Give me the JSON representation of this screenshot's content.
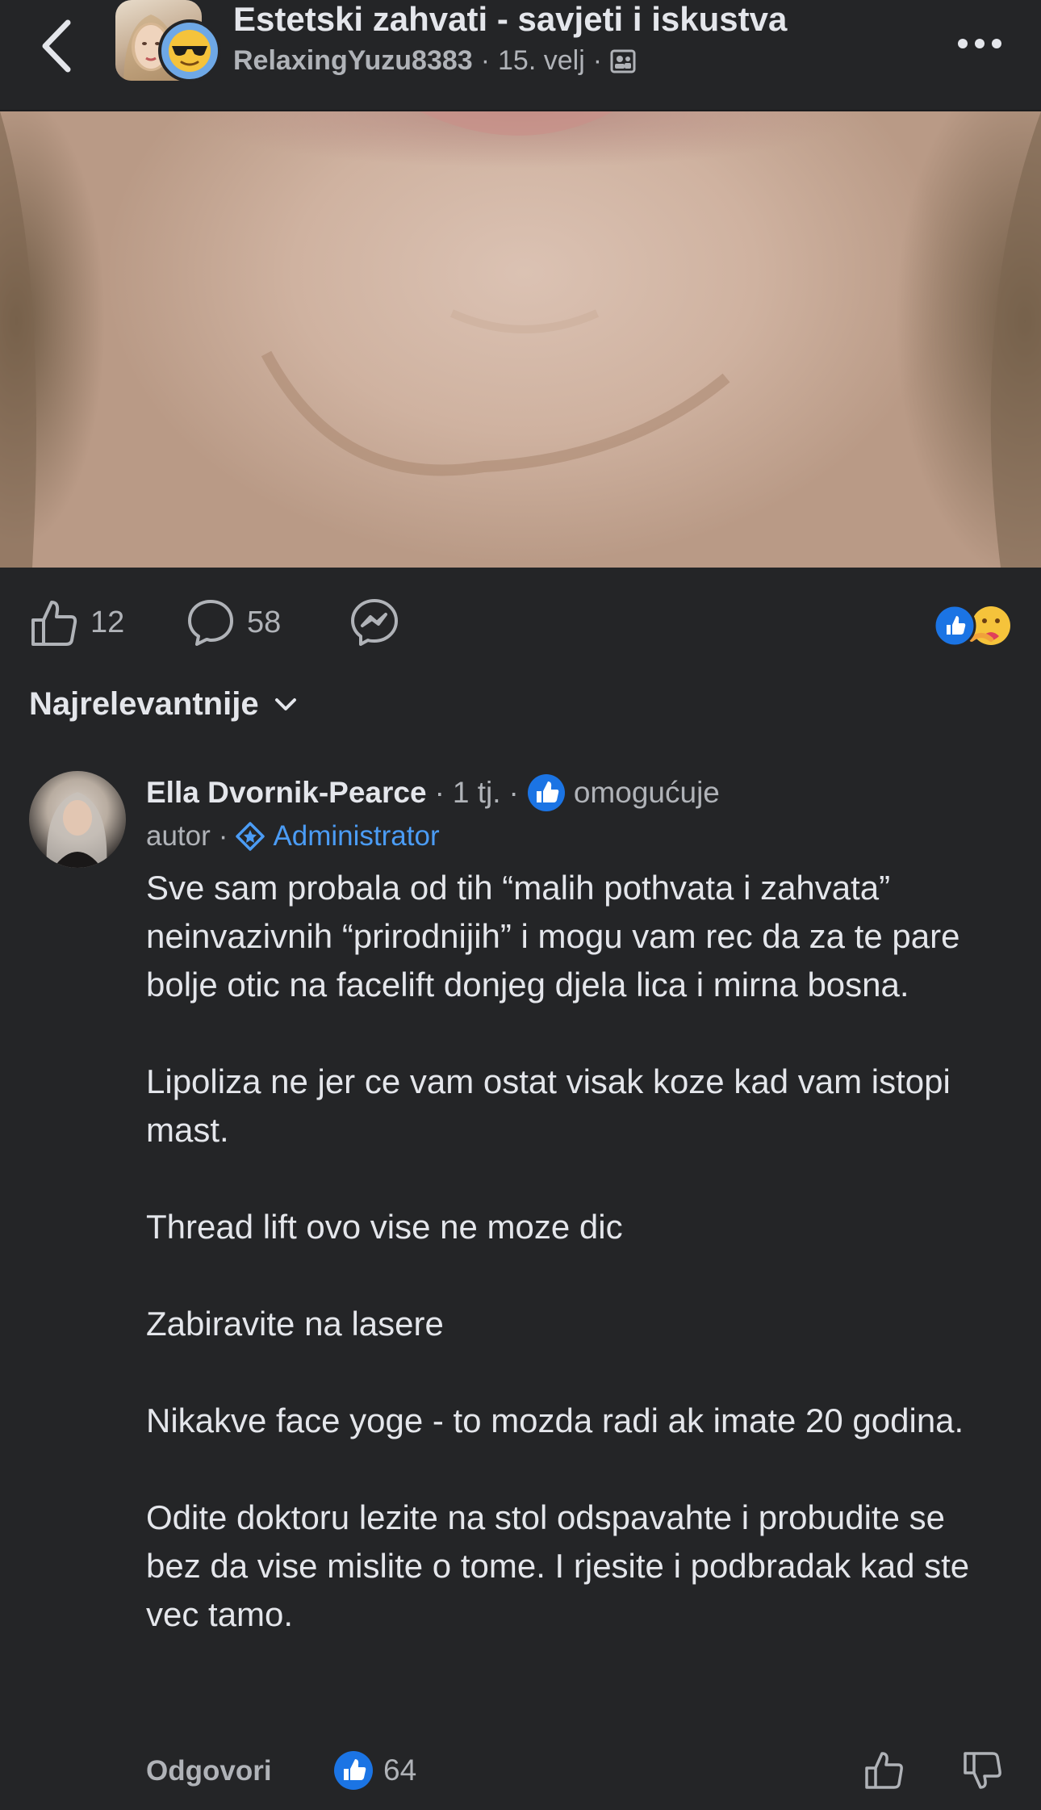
{
  "header": {
    "group_title": "Estetski zahvati - savjeti i iskustva",
    "author": "RelaxingYuzu8383",
    "date": "15. velj"
  },
  "post": {
    "like_count": "12",
    "comment_count": "58"
  },
  "sort": {
    "label": "Najrelevantnije"
  },
  "comment": {
    "author": "Ella Dvornik-Pearce",
    "time": "1 tj.",
    "recommends": "omogućuje",
    "role_author": "autor",
    "role_admin": "Administrator",
    "paragraphs": [
      "Sve sam probala od tih “malih pothvata i zahvata” neinvazivnih “prirodnijih” i mogu vam rec da za te pare bolje otic na facelift donjeg djela lica i mirna bosna.",
      "Lipoliza ne jer ce vam ostat visak koze kad vam istopi mast.",
      "Thread lift ovo vise ne moze dic",
      "Zabiravite na lasere",
      "Nikakve face yoge -  to mozda radi ak imate 20 godina.",
      "Odite doktoru lezite na stol odspavahte i probudite se bez da vise mislite o tome. I rjesite i podbradak kad ste vec tamo."
    ],
    "reply_label": "Odgovori",
    "like_count": "64"
  },
  "colors": {
    "background": "#242527",
    "primary_text": "#e4e6eb",
    "secondary_text": "#b0b3b8",
    "accent_blue": "#4b9cf5",
    "like_blue": "#1b74e4"
  }
}
